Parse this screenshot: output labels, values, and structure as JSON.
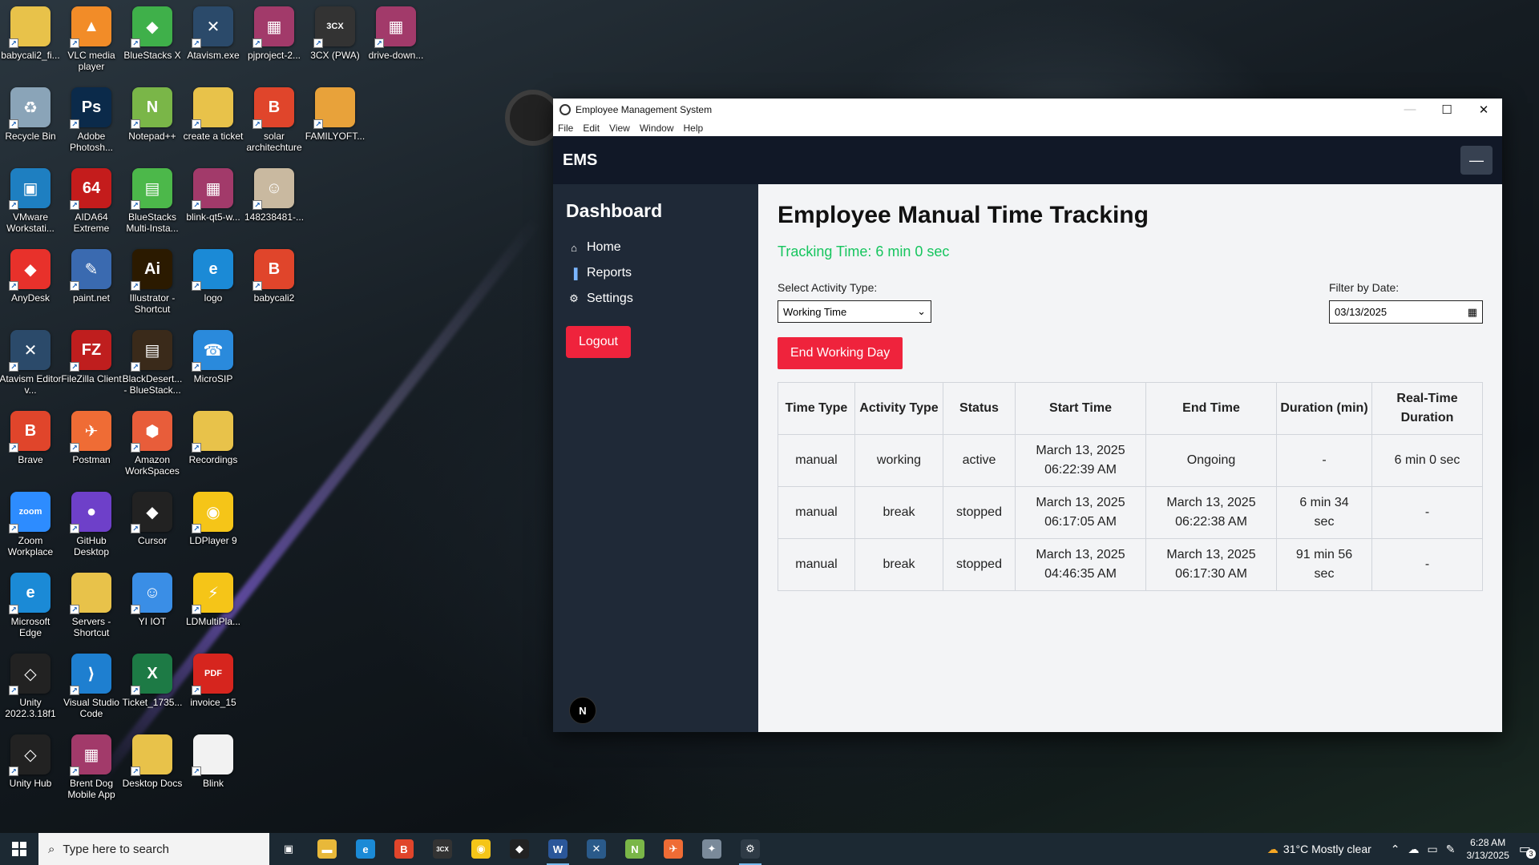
{
  "desktop": {
    "icons": [
      {
        "label": "babycali2_fi...",
        "color": "#e8c24a",
        "glyph": ""
      },
      {
        "label": "VLC media player",
        "color": "#f28c28",
        "glyph": "▲"
      },
      {
        "label": "BlueStacks X",
        "color": "#3fb04a",
        "glyph": "◆"
      },
      {
        "label": "Atavism.exe",
        "color": "#2b4a6a",
        "glyph": "✕"
      },
      {
        "label": "pjproject-2...",
        "color": "#a23a6a",
        "glyph": "▦"
      },
      {
        "label": "3CX (PWA)",
        "color": "#333333",
        "glyph": "3CX"
      },
      {
        "label": "drive-down...",
        "color": "#a23a6a",
        "glyph": "▦"
      },
      {
        "label": "Recycle Bin",
        "color": "#8aa4b8",
        "glyph": "♻"
      },
      {
        "label": "Adobe Photosh...",
        "color": "#0b2a4a",
        "glyph": "Ps"
      },
      {
        "label": "Notepad++",
        "color": "#7ab648",
        "glyph": "N"
      },
      {
        "label": "create a ticket",
        "color": "#e8c24a",
        "glyph": ""
      },
      {
        "label": "solar architechture",
        "color": "#e0452b",
        "glyph": "B"
      },
      {
        "label": "FAMILYOFT...",
        "color": "#e8a23a",
        "glyph": ""
      },
      {
        "label": "VMware Workstati...",
        "color": "#1e7fc1",
        "glyph": "▣"
      },
      {
        "label": "AIDA64 Extreme",
        "color": "#c41c1c",
        "glyph": "64"
      },
      {
        "label": "BlueStacks Multi-Insta...",
        "color": "#4cb84a",
        "glyph": "▤"
      },
      {
        "label": "blink-qt5-w...",
        "color": "#a23a6a",
        "glyph": "▦"
      },
      {
        "label": "148238481-...",
        "color": "#c9b9a0",
        "glyph": "☺"
      },
      {
        "label": "AnyDesk",
        "color": "#e8312b",
        "glyph": "◆"
      },
      {
        "label": "paint.net",
        "color": "#3a6ab0",
        "glyph": "✎"
      },
      {
        "label": "Illustrator - Shortcut",
        "color": "#2b1a00",
        "glyph": "Ai"
      },
      {
        "label": "logo",
        "color": "#1b8ad6",
        "glyph": "e"
      },
      {
        "label": "babycali2",
        "color": "#e0452b",
        "glyph": "B"
      },
      {
        "label": "Atavism Editor v...",
        "color": "#2b4a6a",
        "glyph": "✕"
      },
      {
        "label": "FileZilla Client",
        "color": "#bf1e1e",
        "glyph": "FZ"
      },
      {
        "label": "BlackDesert... - BlueStack...",
        "color": "#3a2a1a",
        "glyph": "▤"
      },
      {
        "label": "MicroSIP",
        "color": "#2a8adc",
        "glyph": "☎"
      },
      {
        "label": "Brave",
        "color": "#e0452b",
        "glyph": "B"
      },
      {
        "label": "Postman",
        "color": "#ef6c35",
        "glyph": "✈"
      },
      {
        "label": "Amazon WorkSpaces",
        "color": "#e85d3a",
        "glyph": "⬢"
      },
      {
        "label": "Recordings",
        "color": "#e8c24a",
        "glyph": ""
      },
      {
        "label": "Zoom Workplace",
        "color": "#2d8cff",
        "glyph": "zoom"
      },
      {
        "label": "GitHub Desktop",
        "color": "#6e40c9",
        "glyph": "●"
      },
      {
        "label": "Cursor",
        "color": "#222222",
        "glyph": "◆"
      },
      {
        "label": "LDPlayer 9",
        "color": "#f5c518",
        "glyph": "◉"
      },
      {
        "label": "Microsoft Edge",
        "color": "#1b8ad6",
        "glyph": "e"
      },
      {
        "label": "Servers - Shortcut",
        "color": "#e8c24a",
        "glyph": ""
      },
      {
        "label": "YI IOT",
        "color": "#3a8ee6",
        "glyph": "☺"
      },
      {
        "label": "LDMultiPla...",
        "color": "#f5c518",
        "glyph": "⚡"
      },
      {
        "label": "Unity 2022.3.18f1",
        "color": "#222222",
        "glyph": "◇"
      },
      {
        "label": "Visual Studio Code",
        "color": "#1e7fd0",
        "glyph": "⟩"
      },
      {
        "label": "Ticket_1735...",
        "color": "#1d7a45",
        "glyph": "X"
      },
      {
        "label": "invoice_15",
        "color": "#d6251e",
        "glyph": "PDF"
      },
      {
        "label": "Unity Hub",
        "color": "#222222",
        "glyph": "◇"
      },
      {
        "label": "Brent Dog Mobile App",
        "color": "#a23a6a",
        "glyph": "▦"
      },
      {
        "label": "Desktop Docs",
        "color": "#e8c24a",
        "glyph": ""
      },
      {
        "label": "Blink",
        "color": "#f2f2f2",
        "glyph": ""
      }
    ]
  },
  "window": {
    "title": "Employee Management System",
    "menu": [
      "File",
      "Edit",
      "View",
      "Window",
      "Help"
    ],
    "controls": {
      "minimize": "—",
      "maximize": "☐",
      "close": "✕"
    }
  },
  "app": {
    "brand": "EMS",
    "menu_toggle": "—",
    "sidebar": {
      "heading": "Dashboard",
      "items": [
        {
          "icon": "home-icon",
          "glyph": "⌂",
          "label": "Home"
        },
        {
          "icon": "chart-icon",
          "glyph": "▐",
          "label": "Reports"
        },
        {
          "icon": "gear-icon",
          "glyph": "⚙",
          "label": "Settings"
        }
      ],
      "logout_label": "Logout",
      "badge": "N"
    },
    "main": {
      "title": "Employee Manual Time Tracking",
      "tracking_status": "Tracking Time: 6 min 0 sec",
      "activity_label": "Select Activity Type:",
      "activity_value": "Working Time",
      "filter_label": "Filter by Date:",
      "filter_value": "03/13/2025",
      "end_day_label": "End Working Day",
      "table": {
        "headers": [
          "Time Type",
          "Activity Type",
          "Status",
          "Start Time",
          "End Time",
          "Duration (min)",
          "Real-Time Duration"
        ],
        "rows": [
          [
            "manual",
            "working",
            "active",
            "March 13, 2025 06:22:39 AM",
            "Ongoing",
            "-",
            "6 min 0 sec"
          ],
          [
            "manual",
            "break",
            "stopped",
            "March 13, 2025 06:17:05 AM",
            "March 13, 2025 06:22:38 AM",
            "6 min 34 sec",
            "-"
          ],
          [
            "manual",
            "break",
            "stopped",
            "March 13, 2025 04:46:35 AM",
            "March 13, 2025 06:17:30 AM",
            "91 min 56 sec",
            "-"
          ]
        ]
      }
    }
  },
  "taskbar": {
    "search_placeholder": "Type here to search",
    "apps": [
      {
        "name": "task-view",
        "color": "#1c2933",
        "glyph": "▣",
        "active": false
      },
      {
        "name": "file-explorer",
        "color": "#e8b83a",
        "glyph": "▬",
        "active": false
      },
      {
        "name": "edge",
        "color": "#1b8ad6",
        "glyph": "e",
        "active": false
      },
      {
        "name": "brave",
        "color": "#e0452b",
        "glyph": "B",
        "active": false
      },
      {
        "name": "3cx",
        "color": "#333333",
        "glyph": "3CX",
        "active": false
      },
      {
        "name": "ldplayer",
        "color": "#f5c518",
        "glyph": "◉",
        "active": false
      },
      {
        "name": "cursor",
        "color": "#222222",
        "glyph": "◆",
        "active": false
      },
      {
        "name": "word",
        "color": "#2b579a",
        "glyph": "W",
        "active": true
      },
      {
        "name": "app-blue",
        "color": "#2a5a8a",
        "glyph": "✕",
        "active": false
      },
      {
        "name": "notepad-plus",
        "color": "#7ab648",
        "glyph": "N",
        "active": false
      },
      {
        "name": "postman",
        "color": "#ef6c35",
        "glyph": "✈",
        "active": false
      },
      {
        "name": "app-bird",
        "color": "#7a8a9a",
        "glyph": "✦",
        "active": false
      },
      {
        "name": "electron-app",
        "color": "#2f3b46",
        "glyph": "⚙",
        "active": true
      }
    ],
    "weather": "31°C  Mostly clear",
    "time": "6:28 AM",
    "date": "3/13/2025",
    "notification_count": "3"
  }
}
